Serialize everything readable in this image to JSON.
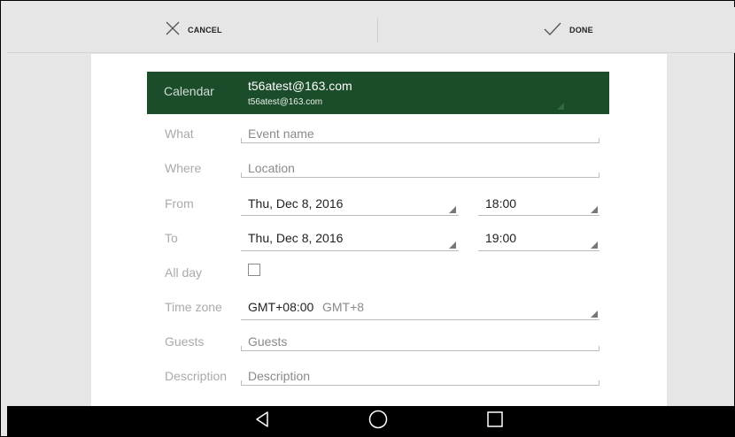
{
  "toolbar": {
    "cancel_label": "CANCEL",
    "done_label": "DONE"
  },
  "form": {
    "calendar": {
      "label": "Calendar",
      "account_name": "t56atest@163.com",
      "account_email": "t56atest@163.com"
    },
    "what": {
      "label": "What",
      "placeholder": "Event name"
    },
    "where": {
      "label": "Where",
      "placeholder": "Location"
    },
    "from": {
      "label": "From",
      "date": "Thu, Dec 8, 2016",
      "time": "18:00"
    },
    "to": {
      "label": "To",
      "date": "Thu, Dec 8, 2016",
      "time": "19:00"
    },
    "all_day": {
      "label": "All day",
      "checked": false
    },
    "time_zone": {
      "label": "Time zone",
      "value": "GMT+08:00",
      "name": "GMT+8"
    },
    "guests": {
      "label": "Guests",
      "placeholder": "Guests"
    },
    "description": {
      "label": "Description",
      "placeholder": "Description"
    }
  },
  "icons": {
    "cancel": "close-icon",
    "done": "check-icon",
    "nav_back": "back-triangle-icon",
    "nav_home": "home-circle-icon",
    "nav_recents": "recents-square-icon"
  },
  "colors": {
    "calendar_band": "#1b4d2b",
    "nav_bar": "#000000",
    "action_bar": "#e6e6e6"
  }
}
